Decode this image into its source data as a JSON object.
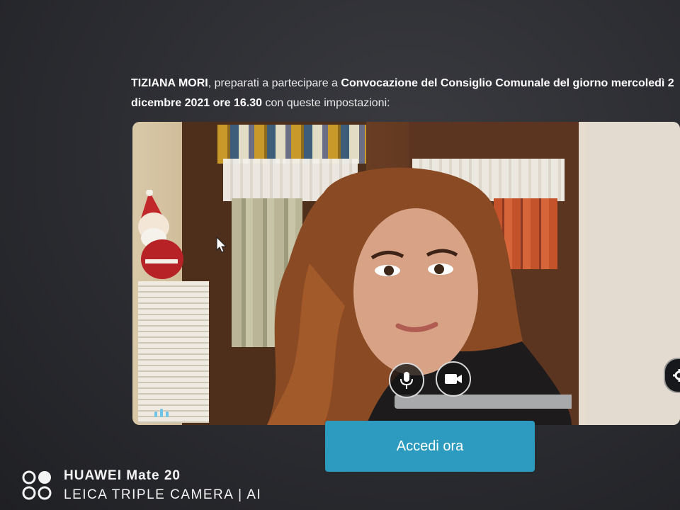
{
  "prompt": {
    "name": "TIZIANA MORI",
    "text_1": ", preparati a partecipare a ",
    "meeting_title": "Convocazione del Consiglio Comunale del giorno mercoledì 2",
    "meeting_date": "dicembre 2021 ore 16.30",
    "text_2": " con queste impostazioni:"
  },
  "preview": {
    "mic_icon": "microphone-icon",
    "camera_icon": "video-camera-icon",
    "settings_icon": "gear-icon",
    "audio_icon": "audio-level-icon"
  },
  "join_button": {
    "label": "Accedi ora"
  },
  "watermark": {
    "line1": "HUAWEI Mate 20",
    "line2": "LEICA TRIPLE CAMERA | AI"
  },
  "colors": {
    "background": "#2b2c31",
    "join_button": "#2d9bbf",
    "text": "#e9e9e9"
  }
}
